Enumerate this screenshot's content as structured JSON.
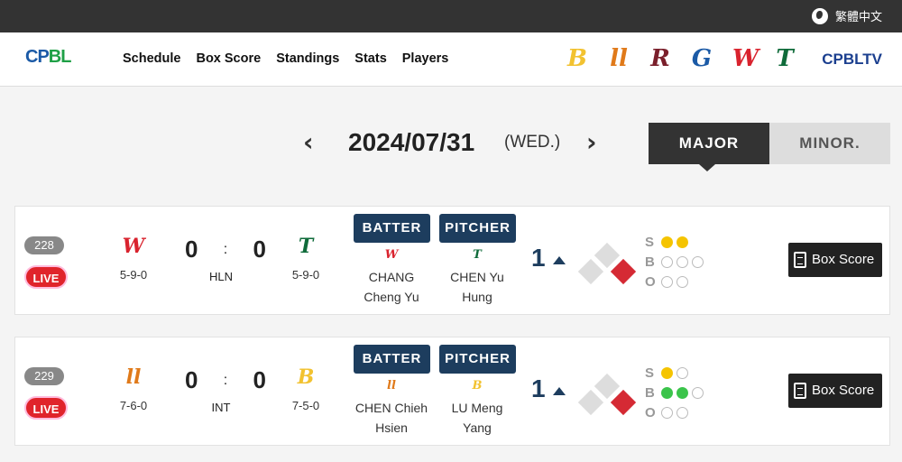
{
  "topbar": {
    "language": "繁體中文"
  },
  "header": {
    "logo": {
      "c": "CP",
      "b": "BL"
    },
    "nav": [
      "Schedule",
      "Box Score",
      "Standings",
      "Stats",
      "Players"
    ],
    "team_logos": [
      {
        "glyph": "B",
        "color": "#f2c230",
        "icon": "brothers-logo-icon"
      },
      {
        "glyph": "ll",
        "color": "#e07a1a",
        "icon": "lions-logo-icon"
      },
      {
        "glyph": "R",
        "color": "#7a1f2b",
        "icon": "monkeys-logo-icon"
      },
      {
        "glyph": "G",
        "color": "#1b5aa6",
        "icon": "guardians-logo-icon"
      },
      {
        "glyph": "W",
        "color": "#d9232e",
        "icon": "dragons-logo-icon"
      },
      {
        "glyph": "T",
        "color": "#0f6b3a",
        "icon": "hawks-logo-icon"
      }
    ],
    "tv": "CPBLTV"
  },
  "datebar": {
    "date": "2024/07/31",
    "dow": "(WED.)",
    "prev": "‹",
    "next": "›"
  },
  "tabs": {
    "major": "MAJOR",
    "minor": "MINOR."
  },
  "labels": {
    "batter": "BATTER",
    "pitcher": "PITCHER",
    "live": "LIVE",
    "box": "Box Score",
    "s": "S",
    "b": "B",
    "o": "O",
    "colon": ":"
  },
  "games": [
    {
      "no": "228",
      "away": {
        "glyph": "W",
        "color": "#d9232e",
        "record": "5-9-0"
      },
      "home": {
        "glyph": "T",
        "color": "#0f6b3a",
        "record": "5-9-0"
      },
      "away_score": "0",
      "home_score": "0",
      "venue": "HLN",
      "batter": {
        "glyph": "W",
        "color": "#d9232e",
        "line1": "CHANG",
        "line2": "Cheng Yu"
      },
      "pitcher": {
        "glyph": "T",
        "color": "#0f6b3a",
        "line1": "CHEN Yu",
        "line2": "Hung"
      },
      "inning": "1",
      "bases": {
        "first": true,
        "second": false,
        "third": false
      },
      "strikes": 2,
      "balls": 0,
      "outs": 0
    },
    {
      "no": "229",
      "away": {
        "glyph": "ll",
        "color": "#e07a1a",
        "record": "7-6-0"
      },
      "home": {
        "glyph": "B",
        "color": "#f2c230",
        "record": "7-5-0"
      },
      "away_score": "0",
      "home_score": "0",
      "venue": "INT",
      "batter": {
        "glyph": "ll",
        "color": "#e07a1a",
        "line1": "CHEN Chieh",
        "line2": "Hsien"
      },
      "pitcher": {
        "glyph": "B",
        "color": "#f2c230",
        "line1": "LU Meng",
        "line2": "Yang"
      },
      "inning": "1",
      "bases": {
        "first": true,
        "second": false,
        "third": false
      },
      "strikes": 1,
      "balls": 2,
      "outs": 0
    }
  ]
}
